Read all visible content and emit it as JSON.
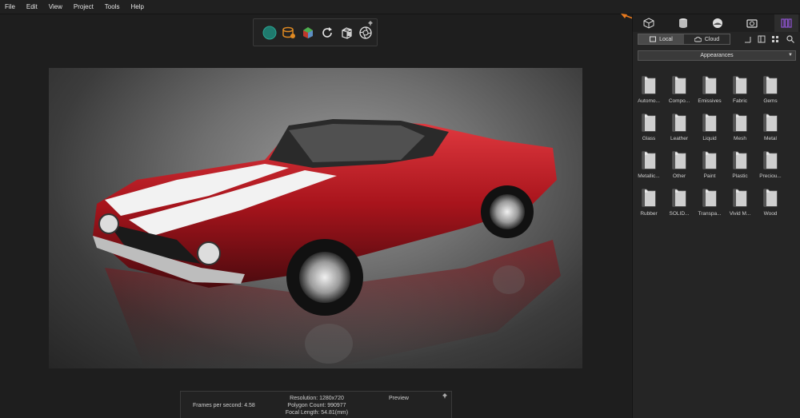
{
  "menu": [
    "File",
    "Edit",
    "View",
    "Project",
    "Tools",
    "Help"
  ],
  "toolbar": {
    "icons": [
      "sphere-icon",
      "render-stack-icon",
      "material-icon",
      "refresh-icon",
      "cube-icon",
      "camera-shutter-icon"
    ]
  },
  "stats": {
    "fps": "Frames per second: 4.58",
    "resolution": "Resolution: 1280x720",
    "polygons": "Polygon Count: 990977",
    "focal": "Focal Length: 54.81(mm)",
    "preview": "Preview"
  },
  "panel": {
    "tabs": [
      "cube-icon",
      "cylinder-icon",
      "environment-icon",
      "camera-icon",
      "library-icon"
    ],
    "local_label": "Local",
    "cloud_label": "Cloud",
    "dropdown_value": "Appearances",
    "folders": [
      "Automo...",
      "Compo...",
      "Emissives",
      "Fabric",
      "Gems",
      "Glass",
      "Leather",
      "Liquid",
      "Mesh",
      "Metal",
      "Metallic...",
      "Other",
      "Paint",
      "Plastic",
      "Preciou...",
      "Rubber",
      "SOLID...",
      "Transpa...",
      "Vivid M...",
      "Wood"
    ]
  },
  "colors": {
    "accent": "#8a52c8",
    "arrow": "#e87a1e",
    "car_red": "#b01820"
  }
}
